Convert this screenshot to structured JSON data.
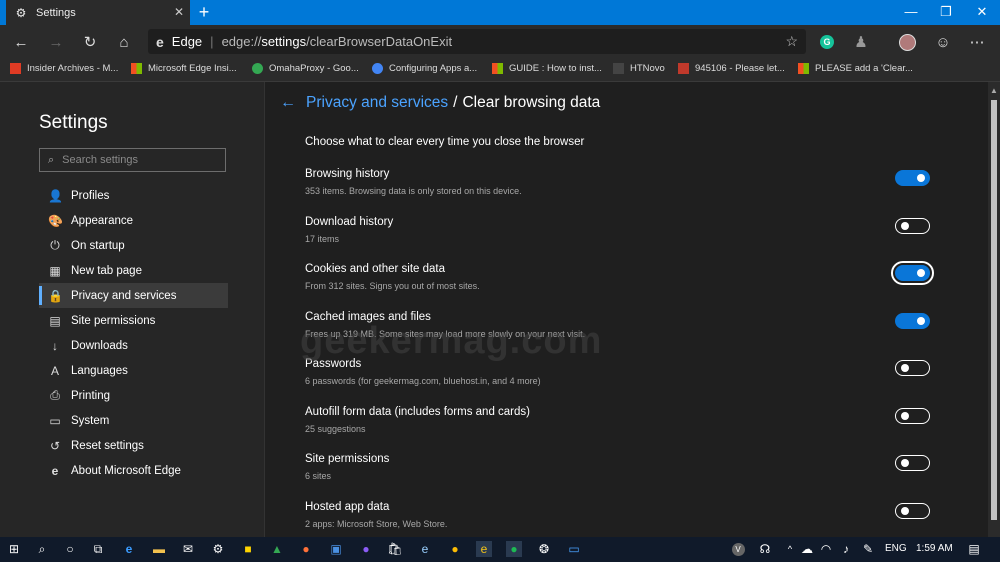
{
  "window": {
    "tab_title": "Settings",
    "tab_close": "✕",
    "new_tab": "+",
    "minimize": "—",
    "restore": "❐",
    "close": "✕"
  },
  "toolbar": {
    "back": "←",
    "forward": "→",
    "refresh": "↻",
    "home": "⌂",
    "brand": "Edge",
    "url_prefix": "edge://",
    "url_host": "settings",
    "url_path": "/clearBrowserDataOnExit",
    "favorite": "☆",
    "more": "⋯"
  },
  "bookmarks": [
    {
      "label": "Insider Archives - M...",
      "color": "#e03b24"
    },
    {
      "label": "Microsoft Edge Insi...",
      "color": "#f25022"
    },
    {
      "label": "OmahaProxy - Goo...",
      "color": "#34a853"
    },
    {
      "label": "Configuring Apps a...",
      "color": "#4285f4"
    },
    {
      "label": "GUIDE : How to inst...",
      "color": "#f25022"
    },
    {
      "label": "HTNovo",
      "color": "#444444"
    },
    {
      "label": "945106 - Please let...",
      "color": "#c0392b"
    },
    {
      "label": "PLEASE add a 'Clear...",
      "color": "#f25022"
    }
  ],
  "sidebar": {
    "title": "Settings",
    "search_placeholder": "Search settings",
    "items": [
      {
        "label": "Profiles",
        "icon": "👤"
      },
      {
        "label": "Appearance",
        "icon": "🎨"
      },
      {
        "label": "On startup",
        "icon": "⏻"
      },
      {
        "label": "New tab page",
        "icon": "▦"
      },
      {
        "label": "Privacy and services",
        "icon": "🔒"
      },
      {
        "label": "Site permissions",
        "icon": "▤"
      },
      {
        "label": "Downloads",
        "icon": "↓"
      },
      {
        "label": "Languages",
        "icon": "A"
      },
      {
        "label": "Printing",
        "icon": "⎙"
      },
      {
        "label": "System",
        "icon": "▭"
      },
      {
        "label": "Reset settings",
        "icon": "↺"
      },
      {
        "label": "About Microsoft Edge",
        "icon": "e"
      }
    ]
  },
  "main": {
    "breadcrumb_parent": "Privacy and services",
    "breadcrumb_sep": "/",
    "breadcrumb_current": "Clear browsing data",
    "section_heading": "Choose what to clear every time you close the browser",
    "watermark": "geekermag.com",
    "rows": [
      {
        "label": "Browsing history",
        "desc": "353 items. Browsing data is only stored on this device.",
        "on": true
      },
      {
        "label": "Download history",
        "desc": "17 items",
        "on": false
      },
      {
        "label": "Cookies and other site data",
        "desc": "From 312 sites. Signs you out of most sites.",
        "on": true
      },
      {
        "label": "Cached images and files",
        "desc": "Frees up 319 MB. Some sites may load more slowly on your next visit.",
        "on": true
      },
      {
        "label": "Passwords",
        "desc": "6 passwords (for geekermag.com, bluehost.in, and 4 more)",
        "on": false
      },
      {
        "label": "Autofill form data (includes forms and cards)",
        "desc": "25 suggestions",
        "on": false
      },
      {
        "label": "Site permissions",
        "desc": "6 sites",
        "on": false
      },
      {
        "label": "Hosted app data",
        "desc": "2 apps: Microsoft Store, Web Store.",
        "on": false
      }
    ]
  },
  "taskbar": {
    "lang": "ENG",
    "time": "1:59 AM"
  },
  "colors": {
    "accent": "#0078d7",
    "link": "#4ba3ff",
    "toggle_on": "#0a76d8"
  }
}
